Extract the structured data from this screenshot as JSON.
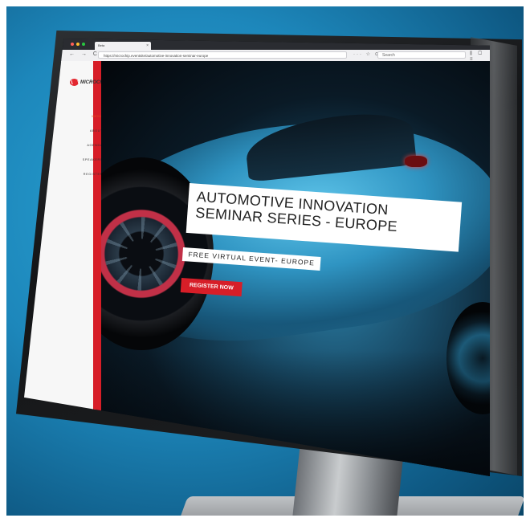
{
  "browser": {
    "tab_title": "Beta",
    "tab_close": "×",
    "url": "https://microchip.eventsite/automotive-innovation-seminar-europe",
    "search_placeholder": "Search",
    "nav_buttons": "← → C ⌂",
    "url_actions": "··· ☆ ⊙",
    "toolbar_icons": "⫼ ▢ ≡"
  },
  "colors": {
    "accent_red": "#d71e28",
    "nav_active": "#e2521e",
    "background_blue": "#1d87bb"
  },
  "sidebar": {
    "logo_text": "MICROCHIP",
    "items": [
      {
        "label": "MENU",
        "active": true
      },
      {
        "label": "ABOUT",
        "active": false
      },
      {
        "label": "AGENDA",
        "active": false
      },
      {
        "label": "SPEAKERS",
        "active": false
      },
      {
        "label": "REGISTER",
        "active": false
      }
    ]
  },
  "hero": {
    "title_line1": "AUTOMOTIVE INNOVATION",
    "title_line2": "SEMINAR SERIES - EUROPE",
    "subtitle": "FREE VIRTUAL EVENT- EUROPE",
    "cta_label": "REGISTER NOW"
  }
}
